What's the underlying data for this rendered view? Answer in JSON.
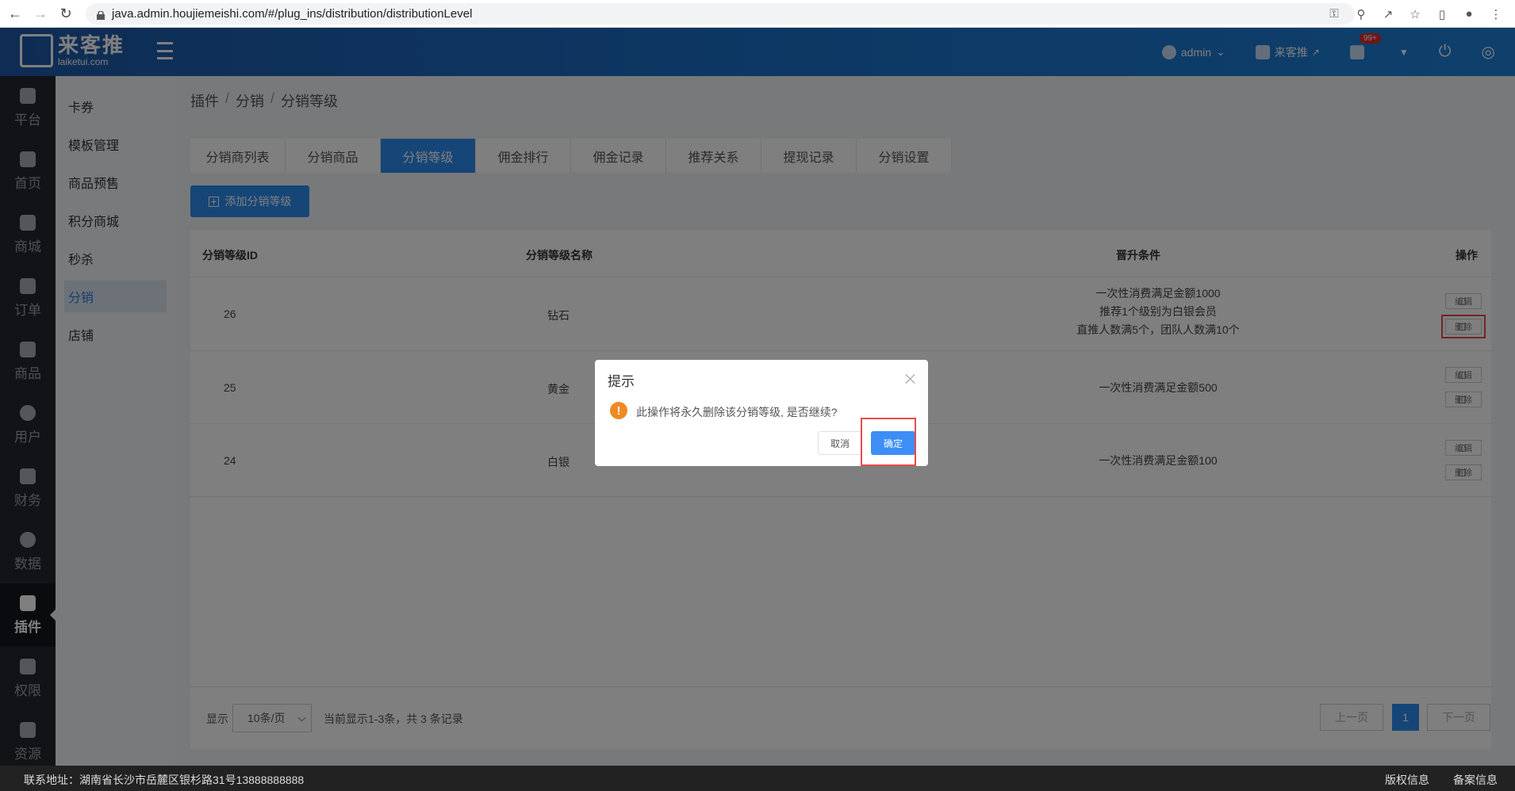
{
  "browser": {
    "url": "java.admin.houjiemeishi.com/#/plug_ins/distribution/distributionLevel"
  },
  "header": {
    "logo_main": "来客推",
    "logo_sub": "laiketui.com",
    "user": "admin",
    "shop": "来客推",
    "notification_badge": "99+",
    "brand_color": "#1a6fc8"
  },
  "nav": {
    "items": [
      {
        "label": "平台",
        "icon": "platform-icon"
      },
      {
        "label": "首页",
        "icon": "home-icon"
      },
      {
        "label": "商城",
        "icon": "mall-icon"
      },
      {
        "label": "订单",
        "icon": "order-icon"
      },
      {
        "label": "商品",
        "icon": "goods-icon"
      },
      {
        "label": "用户",
        "icon": "user-icon"
      },
      {
        "label": "财务",
        "icon": "wallet-icon"
      },
      {
        "label": "数据",
        "icon": "pie-chart-icon"
      },
      {
        "label": "插件",
        "icon": "puzzle-icon"
      },
      {
        "label": "权限",
        "icon": "shield-icon"
      },
      {
        "label": "资源",
        "icon": "image-icon"
      }
    ],
    "active": "插件"
  },
  "subnav": {
    "items": [
      "卡券",
      "模板管理",
      "商品预售",
      "积分商城",
      "秒杀",
      "分销",
      "店铺"
    ],
    "active": "分销"
  },
  "breadcrumb": [
    "插件",
    "分销",
    "分销等级"
  ],
  "tabs": [
    "分销商列表",
    "分销商品",
    "分销等级",
    "佣金排行",
    "佣金记录",
    "推荐关系",
    "提现记录",
    "分销设置"
  ],
  "active_tab": "分销等级",
  "add_button": "添加分销等级",
  "table": {
    "headers": [
      "分销等级ID",
      "分销等级名称",
      "晋升条件",
      "操作"
    ],
    "rows": [
      {
        "id": "26",
        "name": "钻石",
        "cond": [
          "一次性消费满足金额1000",
          "推荐1个级别为白银会员",
          "直推人数满5个，团队人数满10个"
        ]
      },
      {
        "id": "25",
        "name": "黄金",
        "cond": [
          "一次性消费满足金额500"
        ]
      },
      {
        "id": "24",
        "name": "白银",
        "cond": [
          "一次性消费满足金额100"
        ]
      }
    ],
    "edit_label": "编辑",
    "delete_label": "删除"
  },
  "pager": {
    "show_label": "显示",
    "page_size": "10条/页",
    "info": "当前显示1-3条，共 3 条记录",
    "prev": "上一页",
    "current": "1",
    "next": "下一页"
  },
  "footer": {
    "address": "联系地址：湖南省长沙市岳麓区银杉路31号13888888888",
    "copyright": "版权信息",
    "icp": "备案信息"
  },
  "dialog": {
    "title": "提示",
    "message": "此操作将永久删除该分销等级, 是否继续?",
    "cancel": "取消",
    "confirm": "确定"
  }
}
